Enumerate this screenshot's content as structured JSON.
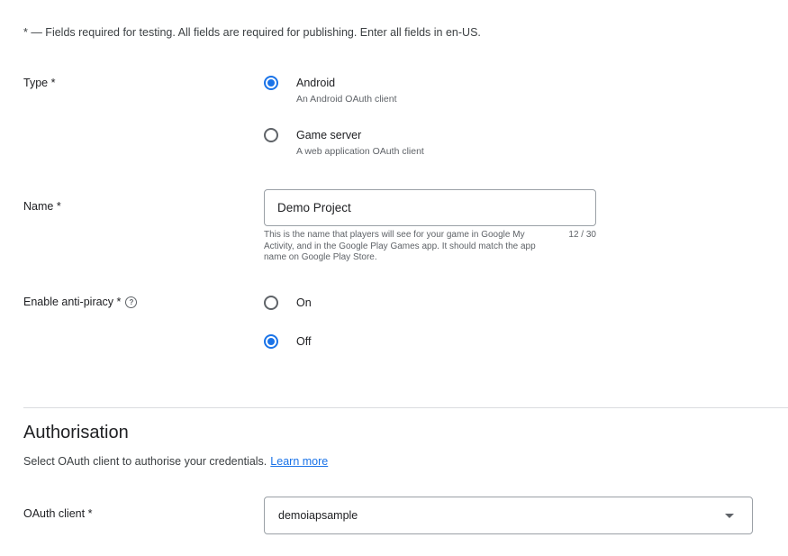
{
  "required_note": "* — Fields required for testing. All fields are required for publishing. Enter all fields in en-US.",
  "type_field": {
    "label": "Type *",
    "options": [
      {
        "label": "Android",
        "description": "An Android OAuth client",
        "selected": true
      },
      {
        "label": "Game server",
        "description": "A web application OAuth client",
        "selected": false
      }
    ]
  },
  "name_field": {
    "label": "Name *",
    "value": "Demo Project",
    "hint": "This is the name that players will see for your game in Google My Activity, and in the Google Play Games app. It should match the app name on Google Play Store.",
    "counter": "12 / 30"
  },
  "anti_piracy_field": {
    "label": "Enable anti-piracy *",
    "help_icon": "help-circle-icon",
    "options": [
      {
        "label": "On",
        "selected": false
      },
      {
        "label": "Off",
        "selected": true
      }
    ]
  },
  "authorisation": {
    "title": "Authorisation",
    "subtitle": "Select OAuth client to authorise your credentials.",
    "learn_more": "Learn more"
  },
  "oauth_field": {
    "label": "OAuth client *",
    "selected_value": "demoiapsample",
    "caret_icon": "dropdown-arrow-icon"
  },
  "colors": {
    "accent": "#1a73e8",
    "border": "#9aa0a6",
    "divider": "#dadce0",
    "secondary_text": "#5f6368"
  }
}
